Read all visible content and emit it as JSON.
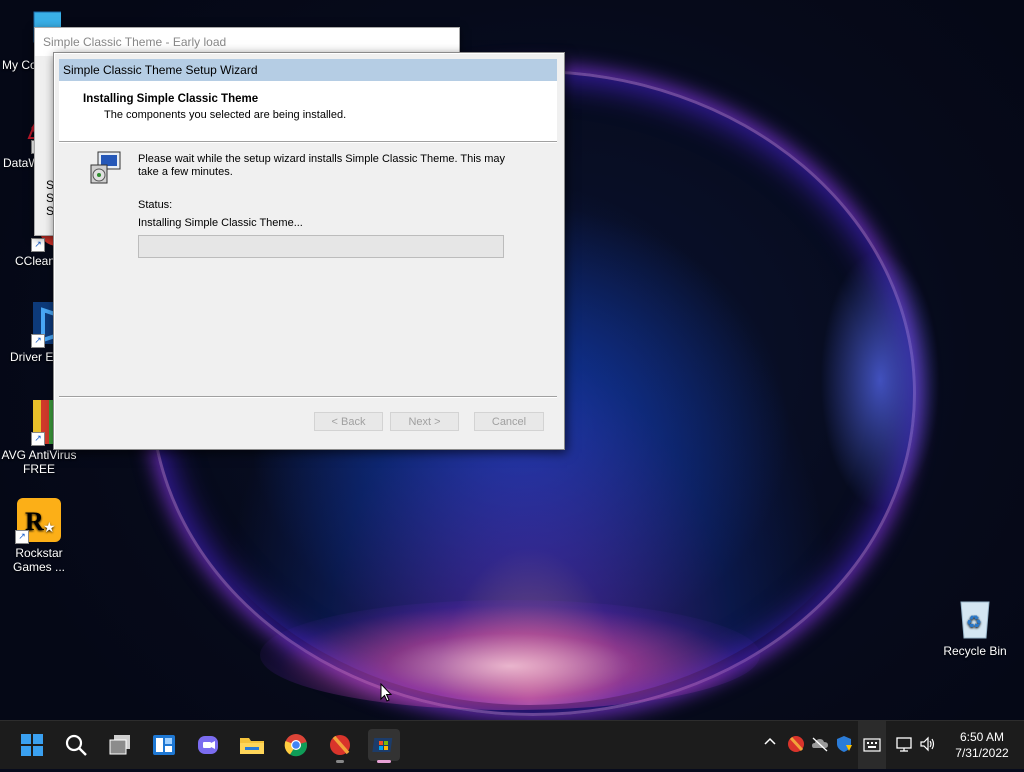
{
  "desktop": {
    "icons": [
      {
        "label": "My Co"
      },
      {
        "label": "DataW"
      },
      {
        "label": "CClean"
      },
      {
        "label": "Driver Ea"
      },
      {
        "label": "AVG AntiVirus FREE"
      },
      {
        "label": "Rockstar Games ..."
      },
      {
        "label": "Recycle Bin"
      }
    ]
  },
  "early_window": {
    "title": "Simple Classic Theme - Early load",
    "partial_text": [
      "S",
      "S",
      "S"
    ]
  },
  "wizard": {
    "title": "Simple Classic Theme Setup Wizard",
    "header_title": "Installing Simple Classic Theme",
    "header_subtitle": "The components you selected are being installed.",
    "message": "Please wait while the setup wizard installs Simple Classic Theme. This may take a few minutes.",
    "status_label": "Status:",
    "status_text": "Installing Simple Classic Theme...",
    "progress": 0,
    "buttons": {
      "back": "< Back",
      "next": "Next >",
      "cancel": "Cancel"
    }
  },
  "taskbar": {
    "apps": [
      "start-icon",
      "search-icon",
      "task-view-icon",
      "widgets-icon",
      "chat-icon",
      "file-explorer-icon",
      "chrome-icon",
      "ccleaner-icon",
      "setup-wizard-icon"
    ],
    "active_app": "setup-wizard-icon",
    "tray": [
      "chevron-up-icon",
      "ccleaner-tray-icon",
      "onedrive-icon",
      "security-icon",
      "keyboard-icon",
      "network-icon",
      "volume-icon"
    ],
    "time": "6:50 AM",
    "date": "7/31/2022"
  },
  "colors": {
    "progress_green": "#06b025",
    "titlebar": "#b5cde4",
    "taskbar": "#1c1c1c",
    "active_indicator": "#e9a2d6"
  }
}
